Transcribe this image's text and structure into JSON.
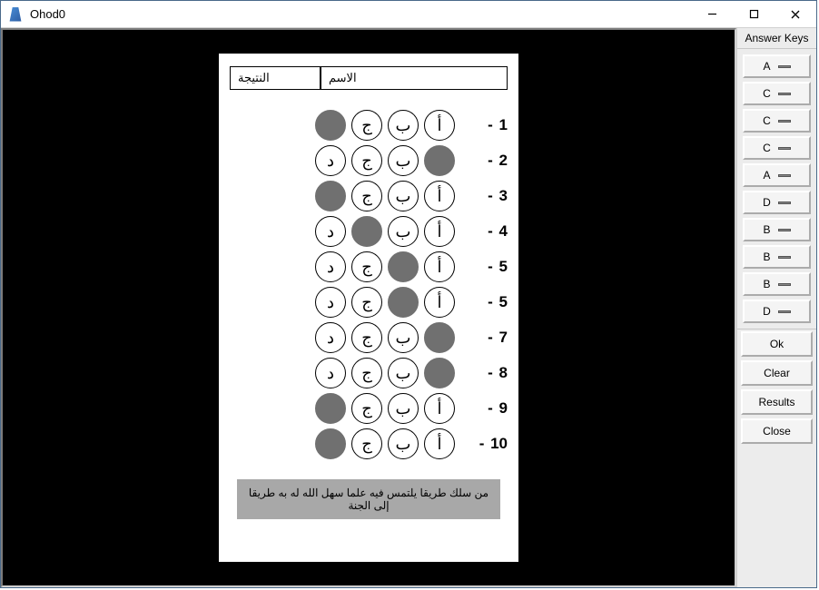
{
  "window": {
    "title": "Ohod0"
  },
  "header": {
    "name_label": "الاسم",
    "result_label": "النتيجة"
  },
  "choice_letters": [
    "أ",
    "ب",
    "ج",
    "د"
  ],
  "questions": [
    {
      "num": "1",
      "filled_index": 3
    },
    {
      "num": "2",
      "filled_index": 0
    },
    {
      "num": "3",
      "filled_index": 3
    },
    {
      "num": "4",
      "filled_index": 2
    },
    {
      "num": "5",
      "filled_index": 1
    },
    {
      "num": "5",
      "filled_index": 1
    },
    {
      "num": "7",
      "filled_index": 0
    },
    {
      "num": "8",
      "filled_index": 0
    },
    {
      "num": "9",
      "filled_index": 3
    },
    {
      "num": "10",
      "filled_index": 3
    }
  ],
  "hadith": "من سلك طريقا يلتمس فيه علما سهل الله له به طريقا إلى الجنة",
  "sidebar": {
    "title": "Answer Keys",
    "keys": [
      "A",
      "C",
      "C",
      "C",
      "A",
      "D",
      "B",
      "B",
      "B",
      "D"
    ],
    "actions": {
      "ok": "Ok",
      "clear": "Clear",
      "results": "Results",
      "close": "Close"
    }
  }
}
